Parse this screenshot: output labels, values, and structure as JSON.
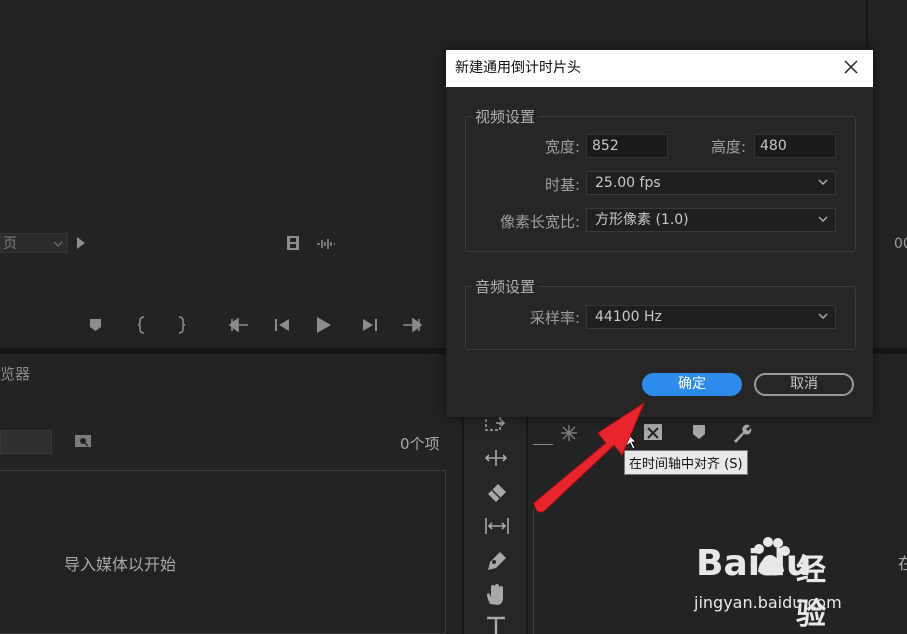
{
  "source_monitor": {
    "page_select": "页",
    "right_timecode": "00"
  },
  "project": {
    "panel_title": "览器",
    "item_count": "0个项",
    "empty_hint": "导入媒体以开始"
  },
  "timeline": {
    "right_char": "在"
  },
  "tooltip": "在时间轴中对齐 (S)",
  "dialog": {
    "title": "新建通用倒计时片头",
    "video_group": "视频设置",
    "width_label": "宽度:",
    "width_value": "852",
    "height_label": "高度:",
    "height_value": "480",
    "timebase_label": "时基:",
    "timebase_value": "25.00 fps",
    "pixel_aspect_label": "像素长宽比:",
    "pixel_aspect_value": "方形像素 (1.0)",
    "audio_group": "音频设置",
    "sample_rate_label": "采样率:",
    "sample_rate_value": "44100 Hz",
    "ok_label": "确定",
    "cancel_label": "取消"
  },
  "watermark": {
    "brand": "Baidu",
    "brand_cn": "经验",
    "url": "jingyan.baidu.com"
  },
  "colors": {
    "accent": "#2d8ceb",
    "annotation_arrow": "#e8242c"
  }
}
